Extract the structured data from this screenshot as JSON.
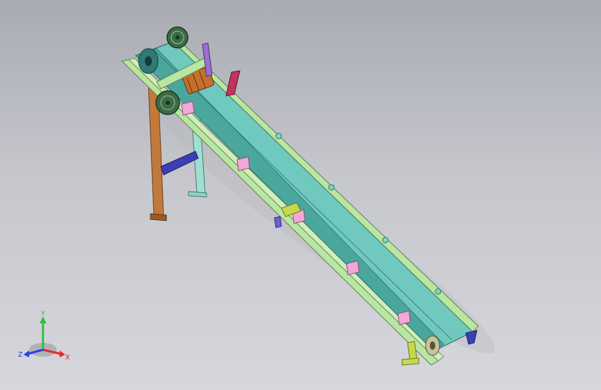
{
  "viewport": {
    "background_top": "#a9abb3",
    "background_bottom": "#d6d7dc"
  },
  "model": {
    "belt_color": "#6fc9bf",
    "belt_shadow": "#4aa79d",
    "frame_color": "#b9e6a2",
    "front_leg_color": "#c27a3c",
    "rear_leg_color": "#9fe0d2",
    "brace_color": "#3c3fb2",
    "idler_color": "#f2a7d8",
    "pulley_color": "#3c6b45",
    "motor_color": "#c4702c",
    "tail_leg_color": "#c7d94a"
  },
  "triad": {
    "x_label": "X",
    "y_label": "Y",
    "z_label": "Z",
    "x_color": "#e02b2b",
    "y_color": "#2fbf3a",
    "z_color": "#2b3ee0"
  }
}
